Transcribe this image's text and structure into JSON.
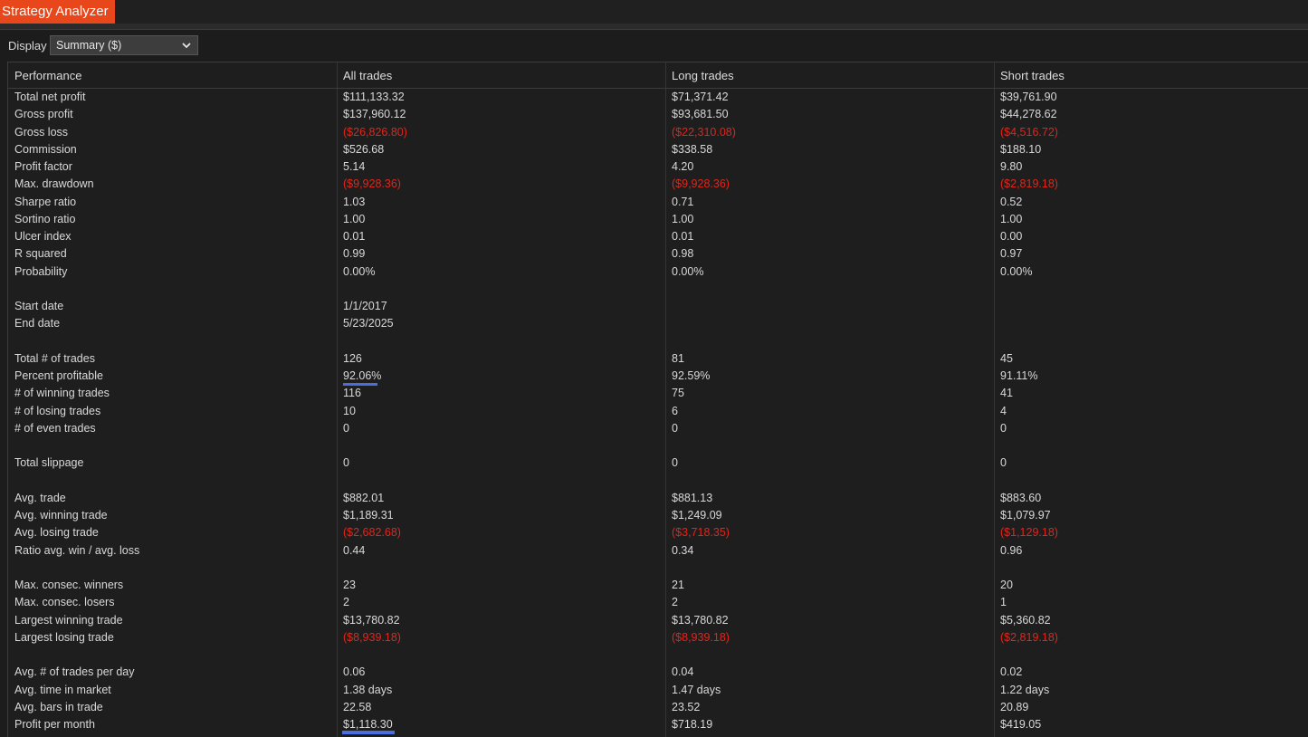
{
  "app": {
    "title": "Strategy Analyzer"
  },
  "display": {
    "label": "Display",
    "selected": "Summary ($)"
  },
  "columns": [
    "Performance",
    "All trades",
    "Long trades",
    "Short trades"
  ],
  "rows": [
    {
      "label": "Total net profit",
      "all": "$111,133.32",
      "long": "$71,371.42",
      "short": "$39,761.90"
    },
    {
      "label": "Gross profit",
      "all": "$137,960.12",
      "long": "$93,681.50",
      "short": "$44,278.62"
    },
    {
      "label": "Gross loss",
      "all": "($26,826.80)",
      "long": "($22,310.08)",
      "short": "($4,516.72)"
    },
    {
      "label": "Commission",
      "all": "$526.68",
      "long": "$338.58",
      "short": "$188.10"
    },
    {
      "label": "Profit factor",
      "all": "5.14",
      "long": "4.20",
      "short": "9.80"
    },
    {
      "label": "Max. drawdown",
      "all": "($9,928.36)",
      "long": "($9,928.36)",
      "short": "($2,819.18)"
    },
    {
      "label": "Sharpe ratio",
      "all": "1.03",
      "long": "0.71",
      "short": "0.52"
    },
    {
      "label": "Sortino ratio",
      "all": "1.00",
      "long": "1.00",
      "short": "1.00"
    },
    {
      "label": "Ulcer index",
      "all": "0.01",
      "long": "0.01",
      "short": "0.00"
    },
    {
      "label": "R squared",
      "all": "0.99",
      "long": "0.98",
      "short": "0.97"
    },
    {
      "label": "Probability",
      "all": "0.00%",
      "long": "0.00%",
      "short": "0.00%"
    },
    {
      "label": "",
      "all": "",
      "long": "",
      "short": ""
    },
    {
      "label": "Start date",
      "all": "1/1/2017",
      "long": "",
      "short": ""
    },
    {
      "label": "End date",
      "all": "5/23/2025",
      "long": "",
      "short": ""
    },
    {
      "label": "",
      "all": "",
      "long": "",
      "short": ""
    },
    {
      "label": "Total # of trades",
      "all": "126",
      "long": "81",
      "short": "45"
    },
    {
      "label": "Percent profitable",
      "all": "92.06%",
      "long": "92.59%",
      "short": "91.11%"
    },
    {
      "label": "# of winning trades",
      "all": "116",
      "long": "75",
      "short": "41"
    },
    {
      "label": "# of losing trades",
      "all": "10",
      "long": "6",
      "short": "4"
    },
    {
      "label": "# of even trades",
      "all": "0",
      "long": "0",
      "short": "0"
    },
    {
      "label": "",
      "all": "",
      "long": "",
      "short": ""
    },
    {
      "label": "Total slippage",
      "all": "0",
      "long": "0",
      "short": "0"
    },
    {
      "label": "",
      "all": "",
      "long": "",
      "short": ""
    },
    {
      "label": "Avg. trade",
      "all": "$882.01",
      "long": "$881.13",
      "short": "$883.60"
    },
    {
      "label": "Avg. winning trade",
      "all": "$1,189.31",
      "long": "$1,249.09",
      "short": "$1,079.97"
    },
    {
      "label": "Avg. losing trade",
      "all": "($2,682.68)",
      "long": "($3,718.35)",
      "short": "($1,129.18)"
    },
    {
      "label": "Ratio avg. win / avg. loss",
      "all": "0.44",
      "long": "0.34",
      "short": "0.96"
    },
    {
      "label": "",
      "all": "",
      "long": "",
      "short": ""
    },
    {
      "label": "Max. consec. winners",
      "all": "23",
      "long": "21",
      "short": "20"
    },
    {
      "label": "Max. consec. losers",
      "all": "2",
      "long": "2",
      "short": "1"
    },
    {
      "label": "Largest winning trade",
      "all": "$13,780.82",
      "long": "$13,780.82",
      "short": "$5,360.82"
    },
    {
      "label": "Largest losing trade",
      "all": "($8,939.18)",
      "long": "($8,939.18)",
      "short": "($2,819.18)"
    },
    {
      "label": "",
      "all": "",
      "long": "",
      "short": ""
    },
    {
      "label": "Avg. # of trades per day",
      "all": "0.06",
      "long": "0.04",
      "short": "0.02"
    },
    {
      "label": "Avg. time in market",
      "all": "1.38 days",
      "long": "1.47 days",
      "short": "1.22 days"
    },
    {
      "label": "Avg. bars in trade",
      "all": "22.58",
      "long": "23.52",
      "short": "20.89"
    },
    {
      "label": "Profit per month",
      "all": "$1,118.30",
      "long": "$718.19",
      "short": "$419.05"
    }
  ],
  "colors": {
    "accent": "#e8461b",
    "negative": "#e0261b",
    "highlight": "#4a6de0"
  }
}
